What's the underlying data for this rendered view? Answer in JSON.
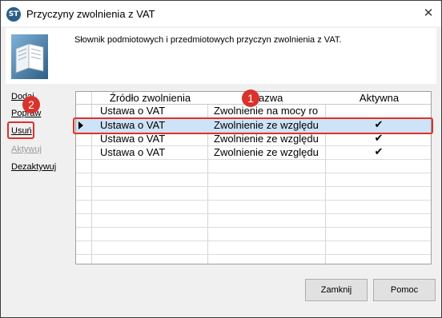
{
  "window": {
    "title": "Przyczyny zwolnienia z VAT",
    "icon_text": "ST",
    "close_glyph": "✕"
  },
  "description": "Słownik podmiotowych i przedmiotowych przyczyn zwolnienia z VAT.",
  "sidebar": {
    "items": [
      {
        "label": "Dodaj",
        "enabled": true
      },
      {
        "label": "Popraw",
        "enabled": true
      },
      {
        "label": "Usuń",
        "enabled": true
      },
      {
        "label": "Aktywuj",
        "enabled": false
      },
      {
        "label": "Dezaktywuj",
        "enabled": true
      }
    ]
  },
  "grid": {
    "columns": [
      "Źródło zwolnienia",
      "Nazwa",
      "Aktywna"
    ],
    "rows": [
      {
        "source": "Ustawa o VAT",
        "name": "Zwolnienie na mocy ro",
        "active": "",
        "selected": false
      },
      {
        "source": "Ustawa o VAT",
        "name": "Zwolnienie ze względu",
        "active": "✔",
        "selected": true
      },
      {
        "source": "Ustawa o VAT",
        "name": "Zwolnienie ze względu",
        "active": "✔",
        "selected": false
      },
      {
        "source": "Ustawa o VAT",
        "name": "Zwolnienie ze względu",
        "active": "✔",
        "selected": false
      }
    ],
    "row_marker": "▶"
  },
  "callouts": {
    "one": "1",
    "two": "2"
  },
  "buttons": {
    "close": "Zamknij",
    "help": "Pomoc"
  },
  "colors": {
    "accent_red": "#d9332c",
    "selection": "#cde3f7"
  }
}
